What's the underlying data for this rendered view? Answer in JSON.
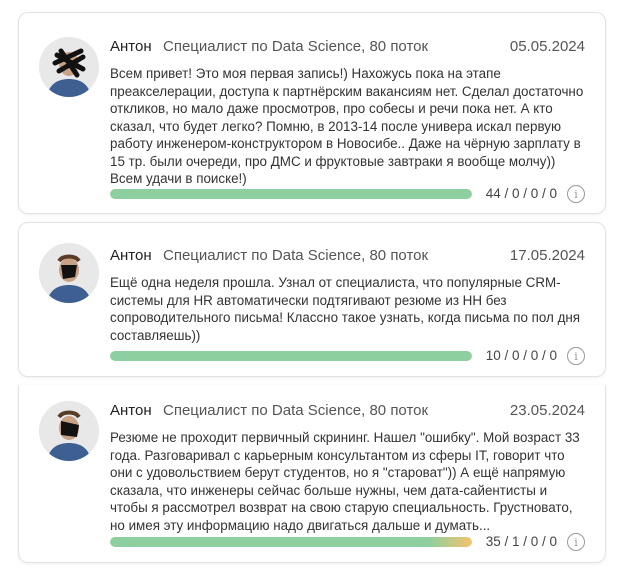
{
  "posts": [
    {
      "author": "Антон",
      "role": "Специалист по Data Science, 80 поток",
      "date": "05.05.2024",
      "text": "Всем привет! Это моя первая запись!) Нахожусь пока на этапе преакселерации, доступа к партнёрским вакансиям нет. Сделал достаточно откликов, но мало даже просмотров, про собесы и речи пока нет. А кто сказал, что будет легко? Помню, в 2013-14 после универа искал первую работу инженером-конструктором в Новосибе.. Даже на чёрную зарплату в 15 тр. были очереди, про ДМС и фруктовые завтраки я вообще молчу)) Всем удачи в поиске!)",
      "counts": "44 / 0 / 0 / 0",
      "progress": 1.0,
      "bar_colors": [
        "#8dcf9e",
        "#8dcf9e"
      ],
      "info_icon": "info-icon"
    },
    {
      "author": "Антон",
      "role": "Специалист по Data Science, 80 поток",
      "date": "17.05.2024",
      "text": "Ещё одна неделя прошла. Узнал от специалиста, что популярные CRM-системы для HR автоматически подтягивают резюме из HH без сопроводительного письма! Классно такое узнать, когда письма по пол дня составляешь))",
      "counts": "10 / 0 / 0 / 0",
      "progress": 1.0,
      "bar_colors": [
        "#8dcf9e",
        "#8dcf9e"
      ],
      "info_icon": "info-icon"
    },
    {
      "author": "Антон",
      "role": "Специалист по Data Science, 80 поток",
      "date": "23.05.2024",
      "text": "Резюме не проходит первичный скрининг. Нашел \"ошибку\". Мой возраст 33 года. Разговаривал с карьерным консультантом из сферы IT, говорит что они с удовольствием берут студентов, но я \"староват\")) А ещё напрямую сказала, что инженеры сейчас больше нужны, чем дата-сайентисты и чтобы я рассмотрел возврат на свою старую специальность. Грустновато, но имея эту информацию надо двигаться дальше и думать...",
      "counts": "35 / 1 / 0 / 0",
      "progress": 1.0,
      "bar_colors": [
        "#8dcf9e",
        "#f5c36e"
      ],
      "info_icon": "info-icon"
    }
  ]
}
